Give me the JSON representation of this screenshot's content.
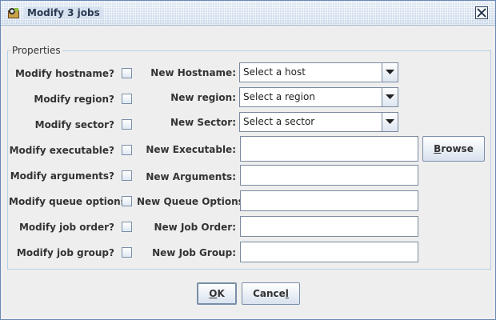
{
  "window": {
    "title": "Modify 3 jobs"
  },
  "group": {
    "title": "Properties"
  },
  "rows": [
    {
      "check_label": "Modify hostname?",
      "field_label": "New Hostname:",
      "kind": "combo",
      "value": "Select a host"
    },
    {
      "check_label": "Modify region?",
      "field_label": "New region:",
      "kind": "combo",
      "value": "Select a region"
    },
    {
      "check_label": "Modify sector?",
      "field_label": "New Sector:",
      "kind": "combo",
      "value": "Select a sector"
    },
    {
      "check_label": "Modify executable?",
      "field_label": "New Executable:",
      "kind": "text",
      "value": ""
    },
    {
      "check_label": "Modify arguments?",
      "field_label": "New Arguments:",
      "kind": "text",
      "value": ""
    },
    {
      "check_label": "Modify queue options?",
      "field_label": "New Queue Options:",
      "kind": "text",
      "value": ""
    },
    {
      "check_label": "Modify job order?",
      "field_label": "New Job Order:",
      "kind": "text",
      "value": ""
    },
    {
      "check_label": "Modify job group?",
      "field_label": "New Job Group:",
      "kind": "text",
      "value": ""
    }
  ],
  "buttons": {
    "browse": {
      "mnemonic": "B",
      "rest": "rowse"
    },
    "ok": {
      "mnemonic": "O",
      "rest": "K"
    },
    "cancel": {
      "pre": "Cance",
      "mnemonic": "l"
    }
  }
}
